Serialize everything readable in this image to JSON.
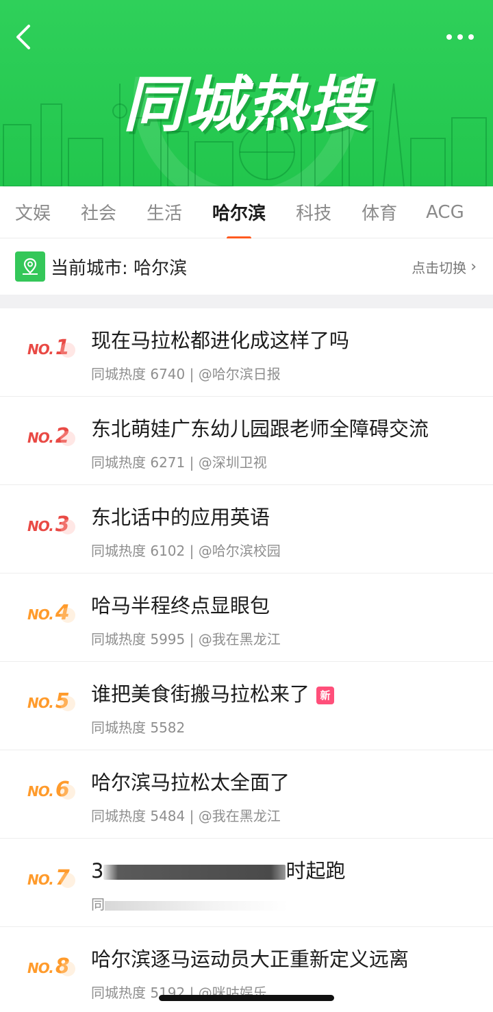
{
  "header": {
    "title": "同城热搜",
    "back_icon": "chevron-left-icon",
    "more_icon": "more-dots-icon",
    "colors": {
      "banner": "#22c64d",
      "accent": "#ff5a1f"
    }
  },
  "tabs": [
    {
      "label": "文娱",
      "active": false
    },
    {
      "label": "社会",
      "active": false
    },
    {
      "label": "生活",
      "active": false
    },
    {
      "label": "哈尔滨",
      "active": true
    },
    {
      "label": "科技",
      "active": false
    },
    {
      "label": "体育",
      "active": false
    },
    {
      "label": "ACG",
      "active": false
    }
  ],
  "city": {
    "icon": "location-map-icon",
    "label": "当前城市: 哈尔滨",
    "switch_label": "点击切换"
  },
  "list": [
    {
      "rank": "1",
      "title": "现在马拉松都进化成这样了吗",
      "meta": "同城热度 6740 | @哈尔滨日报",
      "new": false
    },
    {
      "rank": "2",
      "title": "东北萌娃广东幼儿园跟老师全障碍交流",
      "meta": "同城热度 6271 | @深圳卫视",
      "new": false
    },
    {
      "rank": "3",
      "title": "东北话中的应用英语",
      "meta": "同城热度 6102 | @哈尔滨校园",
      "new": false
    },
    {
      "rank": "4",
      "title": "哈马半程终点显眼包",
      "meta": "同城热度 5995 | @我在黑龙江",
      "new": false
    },
    {
      "rank": "5",
      "title": "谁把美食街搬马拉松来了",
      "meta": "同城热度 5582",
      "new": true,
      "new_label": "新"
    },
    {
      "rank": "6",
      "title": "哈尔滨马拉松太全面了",
      "meta": "同城热度 5484 | @我在黑龙江",
      "new": false
    },
    {
      "rank": "7",
      "title_prefix": "3",
      "title_suffix": "时起跑",
      "meta_prefix": "同",
      "new": false
    },
    {
      "rank": "8",
      "title": "哈尔滨逐马运动员大正重新定义远离",
      "meta": "同城热度 5192 | @咪咕娱乐",
      "new": false
    }
  ],
  "rank_prefix": "NO."
}
